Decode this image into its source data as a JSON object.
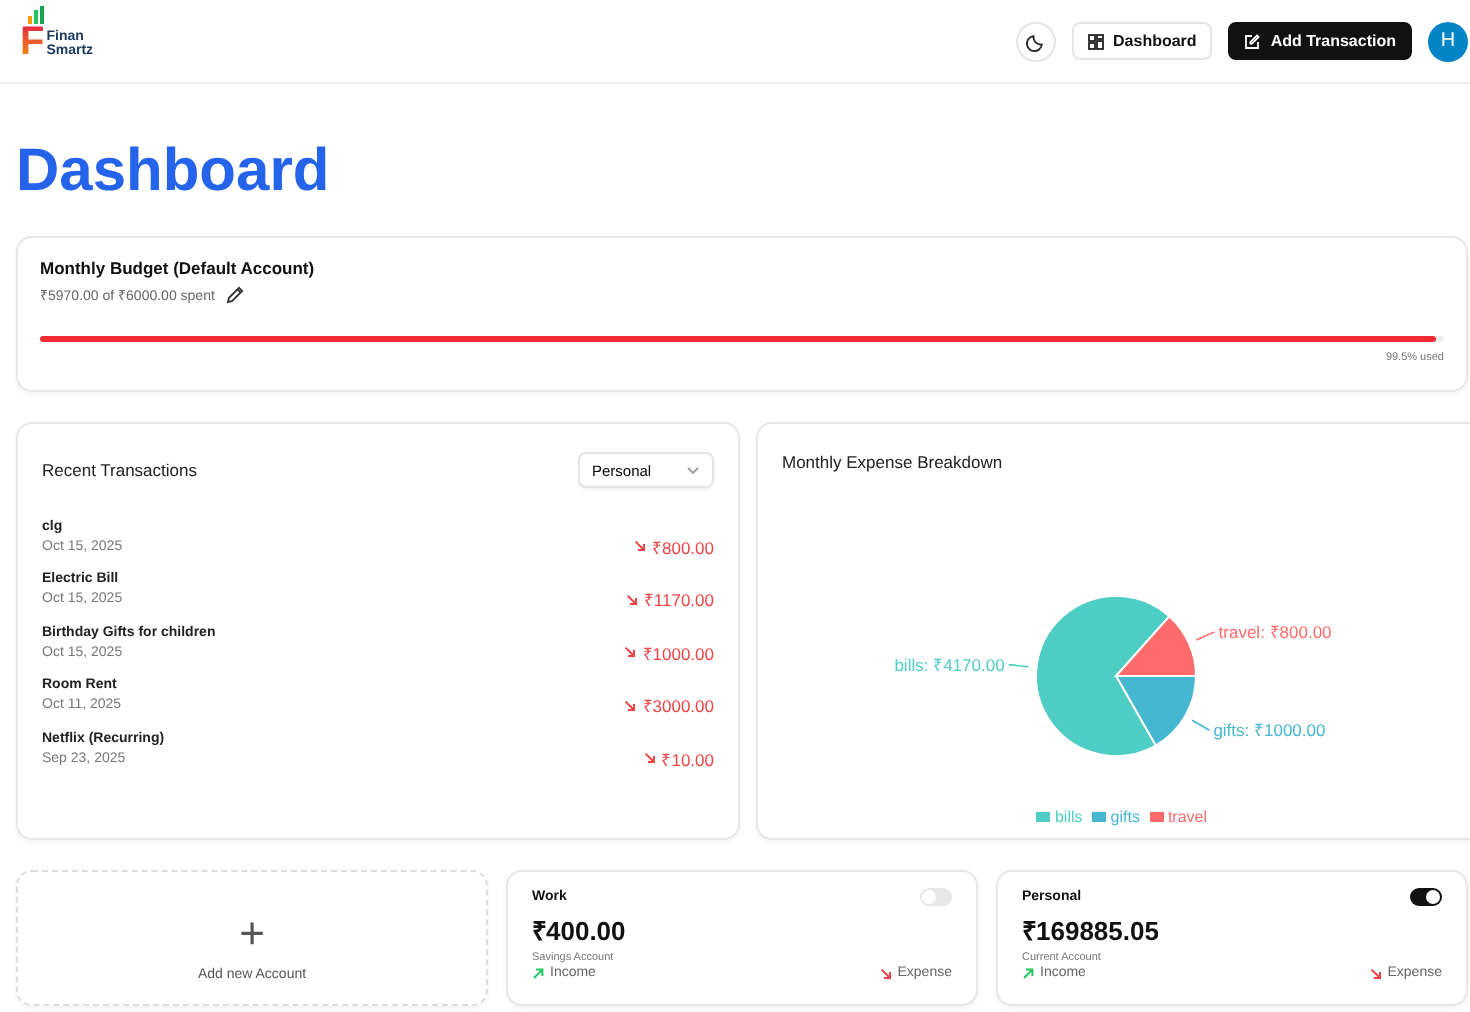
{
  "header": {
    "logo_mark": "F",
    "logo_text": [
      "Finan",
      "Smartz"
    ],
    "nav_button": "Dashboard",
    "add_button": "Add Transaction",
    "avatar": "H"
  },
  "title": "Dashboard",
  "budget": {
    "title": "Monthly Budget (Default Account)",
    "spent": "₹5970.00 of ₹6000.00 spent",
    "level": 0.995,
    "used": "99.5% used"
  },
  "transactions": {
    "title": "Recent Transactions",
    "account_select": "Personal",
    "rows": [
      {
        "name": "clg",
        "date": "Oct 15, 2025",
        "amount": "₹800.00"
      },
      {
        "name": "Electric Bill",
        "date": "Oct 15, 2025",
        "amount": "₹1170.00"
      },
      {
        "name": "Birthday Gifts for children",
        "date": "Oct 15, 2025",
        "amount": "₹1000.00"
      },
      {
        "name": "Room Rent",
        "date": "Oct 11, 2025",
        "amount": "₹3000.00"
      },
      {
        "name": "Netflix (Recurring)",
        "date": "Sep 23, 2025",
        "amount": "₹10.00"
      }
    ]
  },
  "expense_breakdown": {
    "title": "Monthly Expense Breakdown",
    "chart_data": {
      "type": "pie",
      "categories": [
        "bills",
        "gifts",
        "travel"
      ],
      "values": [
        4170,
        1000,
        800
      ],
      "colors": [
        "#4ecdc4",
        "#45b7d1",
        "#ff6b6b"
      ],
      "value_labels": [
        "bills: ₹4170.00",
        "gifts: ₹1000.00",
        "travel: ₹800.00"
      ],
      "legend": true
    }
  },
  "accounts": {
    "add_label": "Add new Account",
    "add_icon": "+",
    "items": [
      {
        "name": "Work",
        "on": false,
        "balance": "₹400.00",
        "type": "Savings Account",
        "income": "Income",
        "expense": "Expense"
      },
      {
        "name": "Personal",
        "on": true,
        "balance": "₹169885.05",
        "type": "Current Account",
        "income": "Income",
        "expense": "Expense"
      }
    ]
  }
}
